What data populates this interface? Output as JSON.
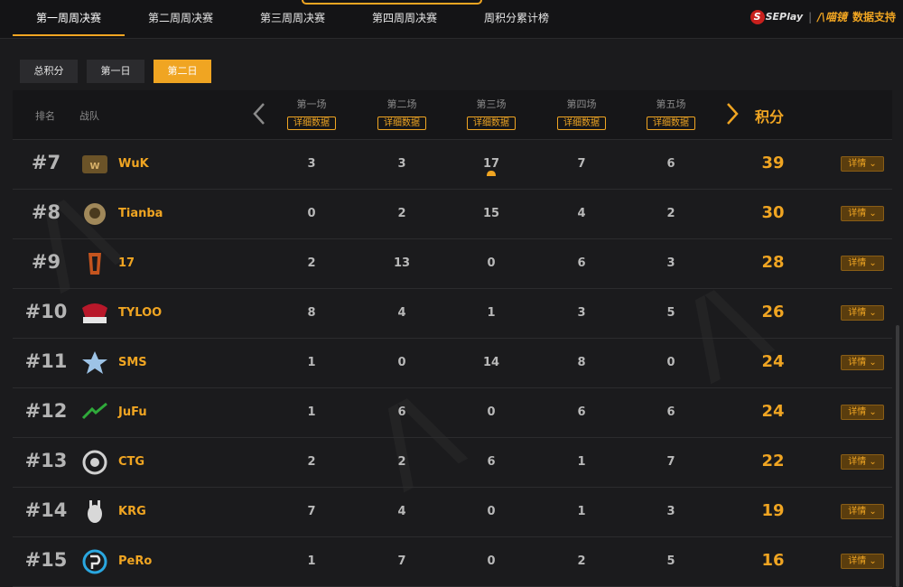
{
  "nav": {
    "tabs": [
      "第一周周决赛",
      "第二周周决赛",
      "第三周周决赛",
      "第四周周决赛",
      "周积分累计榜"
    ],
    "active_index": 0,
    "sponsor": {
      "brand_sp": "SEPlay",
      "brand_main": "/\\喵镜",
      "support": "数据支持"
    }
  },
  "days": {
    "items": [
      "总积分",
      "第一日",
      "第二日"
    ],
    "active_index": 2
  },
  "table": {
    "rank_header": "排名",
    "team_header": "战队",
    "games": [
      "第一场",
      "第二场",
      "第三场",
      "第四场",
      "第五场"
    ],
    "game_detail_label": "详细数据",
    "score_header": "积分",
    "detail_label": "详情",
    "rows": [
      {
        "rank": "#7",
        "team": "WuK",
        "games": [
          "3",
          "3",
          "17",
          "7",
          "6"
        ],
        "score": "39"
      },
      {
        "rank": "#8",
        "team": "Tianba",
        "games": [
          "0",
          "2",
          "15",
          "4",
          "2"
        ],
        "score": "30"
      },
      {
        "rank": "#9",
        "team": "17",
        "games": [
          "2",
          "13",
          "0",
          "6",
          "3"
        ],
        "score": "28"
      },
      {
        "rank": "#10",
        "team": "TYLOO",
        "games": [
          "8",
          "4",
          "1",
          "3",
          "5"
        ],
        "score": "26"
      },
      {
        "rank": "#11",
        "team": "SMS",
        "games": [
          "1",
          "0",
          "14",
          "8",
          "0"
        ],
        "score": "24"
      },
      {
        "rank": "#12",
        "team": "JuFu",
        "games": [
          "1",
          "6",
          "0",
          "6",
          "6"
        ],
        "score": "24"
      },
      {
        "rank": "#13",
        "team": "CTG",
        "games": [
          "2",
          "2",
          "6",
          "1",
          "7"
        ],
        "score": "22"
      },
      {
        "rank": "#14",
        "team": "KRG",
        "games": [
          "7",
          "4",
          "0",
          "1",
          "3"
        ],
        "score": "19"
      },
      {
        "rank": "#15",
        "team": "PeRo",
        "games": [
          "1",
          "7",
          "0",
          "2",
          "5"
        ],
        "score": "16"
      }
    ]
  },
  "colors": {
    "accent": "#f0a522",
    "background": "#1b1b1d"
  }
}
